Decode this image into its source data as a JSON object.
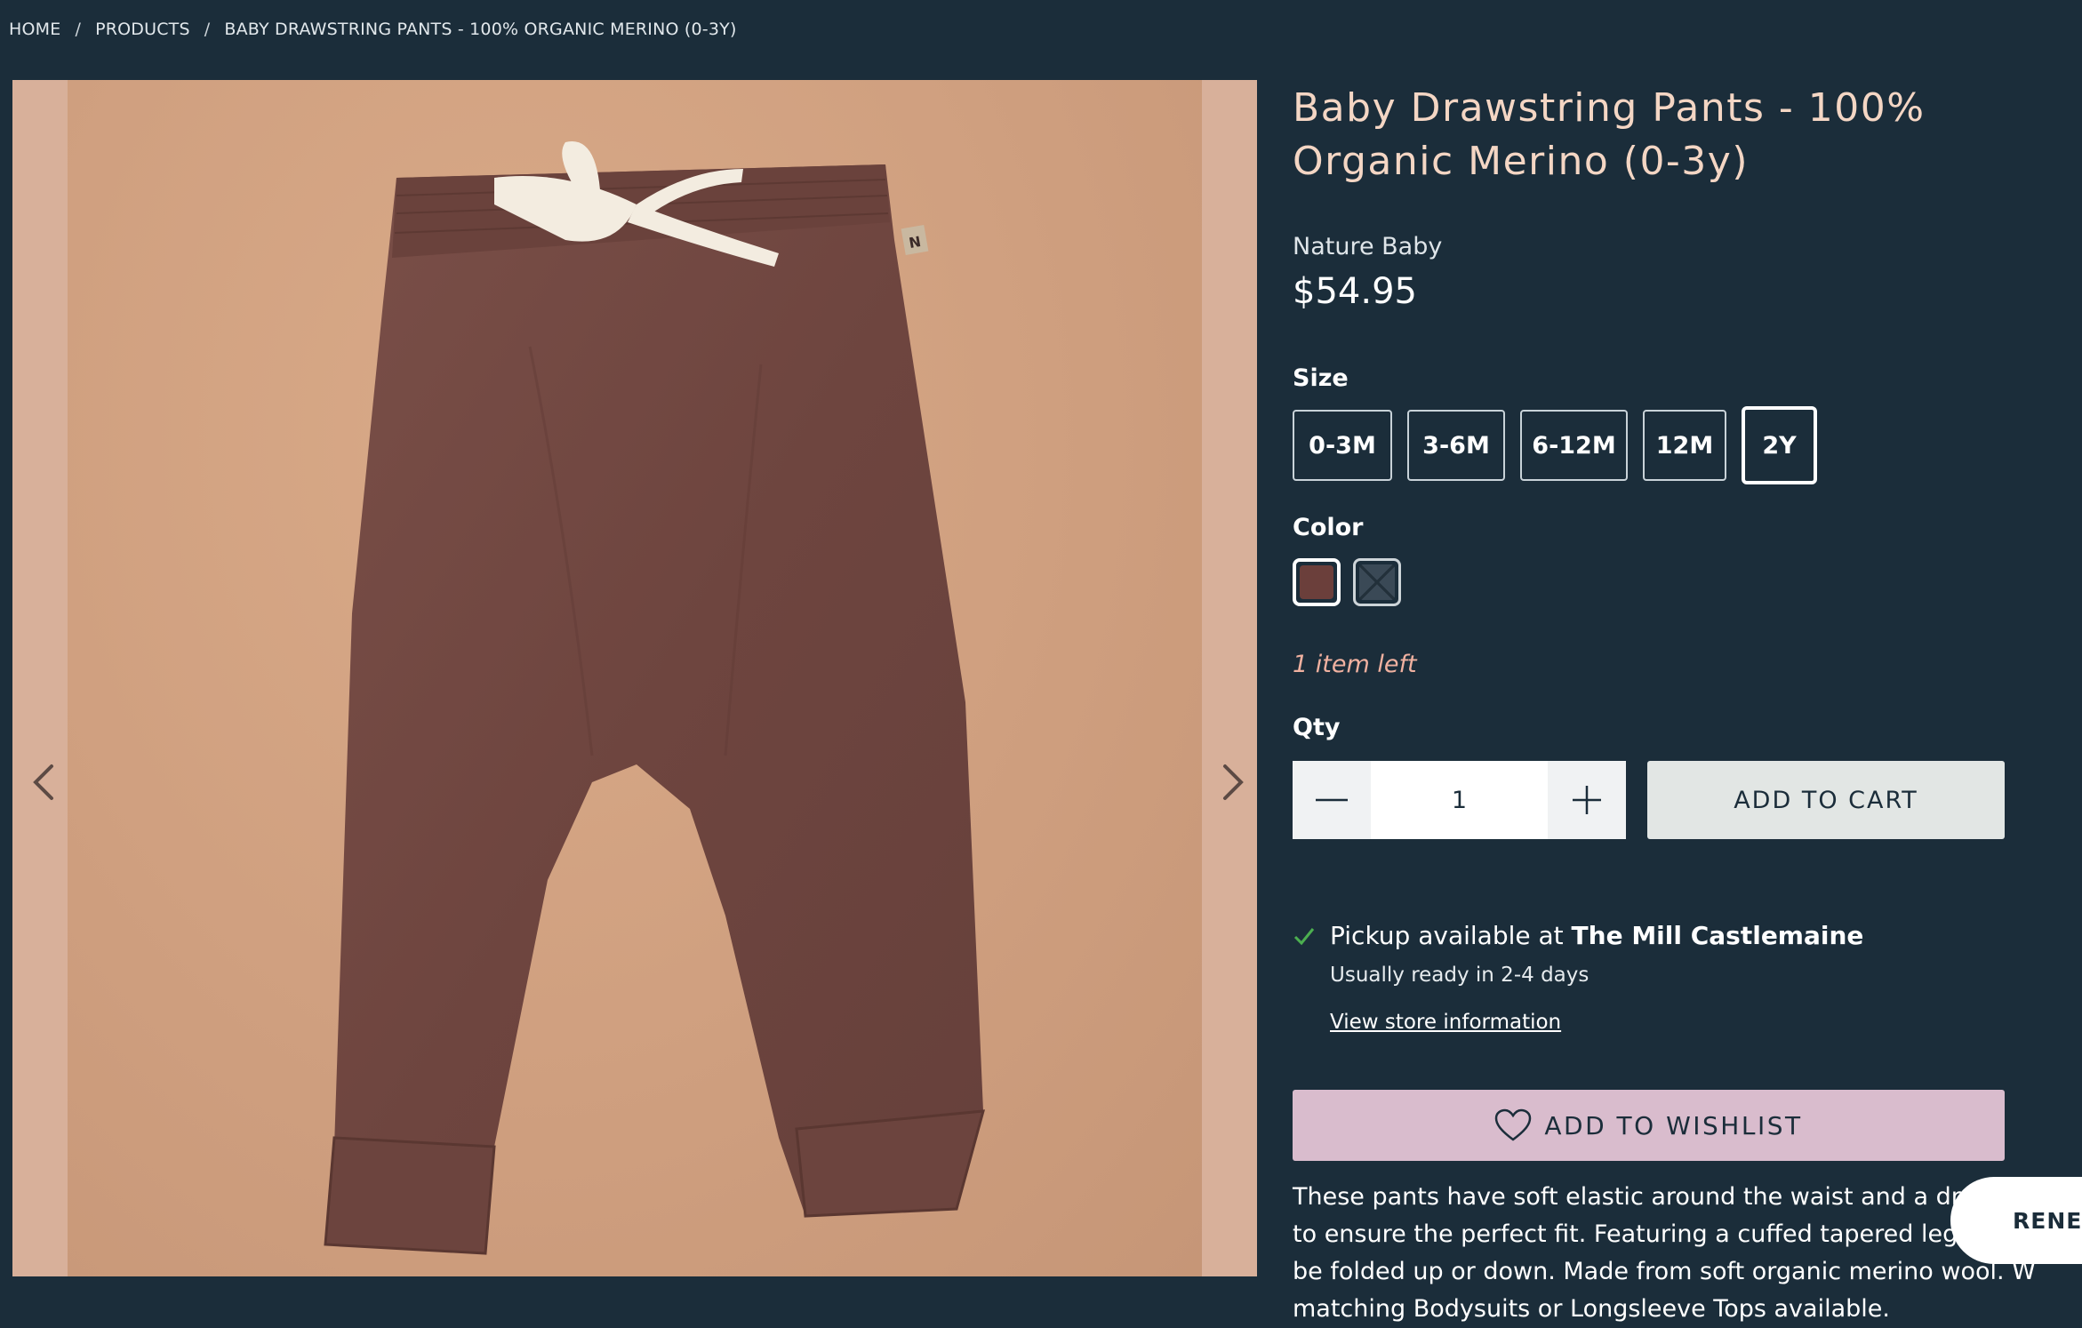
{
  "breadcrumb": {
    "home": "HOME",
    "products": "PRODUCTS",
    "current": "BABY DRAWSTRING PANTS - 100% ORGANIC MERINO (0-3Y)",
    "separator": "/"
  },
  "gallery": {
    "prev_icon": "chevron-left-icon",
    "next_icon": "chevron-right-icon"
  },
  "product": {
    "title": "Baby Drawstring Pants - 100% Organic Merino (0-3y)",
    "vendor": "Nature Baby",
    "price": "$54.95",
    "size_label": "Size",
    "sizes": [
      "0-3M",
      "3-6M",
      "6-12M",
      "12M",
      "2Y"
    ],
    "selected_size": "2Y",
    "color_label": "Color",
    "colors": [
      {
        "name": "brown",
        "hex": "#6b3f3b",
        "selected": true
      },
      {
        "name": "navy",
        "hex": "#3a4956",
        "selected": false
      }
    ],
    "stock_note": "1 item left",
    "qty_label": "Qty",
    "qty_value": "1",
    "add_to_cart": "ADD TO CART",
    "pickup_prefix": "Pickup available at ",
    "pickup_store": "The Mill Castlemaine",
    "pickup_ready": "Usually ready in 2-4 days",
    "store_info_link": "View store information",
    "add_to_wishlist": "ADD TO WISHLIST",
    "description": "These pants have soft elastic around the waist and a drawstring to ensure the perfect fit. Featuring a cuffed tapered leg that can be folded up or down. Made from soft organic merino wool. W matching Bodysuits or Longsleeve Tops available."
  },
  "renew_badge": "RENEW",
  "colors": {
    "background": "#1b2d3a",
    "title": "#f4d6c4",
    "stock": "#f0b1a0",
    "wishlist": "#d9bccd",
    "cart": "#e2e6e4",
    "check": "#4caf50"
  }
}
